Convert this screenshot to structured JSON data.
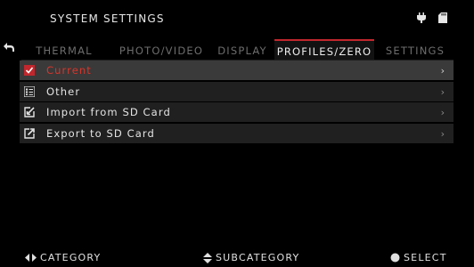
{
  "header": {
    "title": "SYSTEM SETTINGS",
    "status_icons": [
      "plug-icon",
      "sd-card-icon"
    ]
  },
  "back_icon": "back-arrow-icon",
  "tabs": [
    {
      "label": "THERMAL",
      "active": false
    },
    {
      "label": "PHOTO/VIDEO",
      "active": false
    },
    {
      "label": "DISPLAY",
      "active": false
    },
    {
      "label": "PROFILES/ZERO",
      "active": true
    },
    {
      "label": "SETTINGS",
      "active": false
    }
  ],
  "menu": {
    "items": [
      {
        "label": "Current",
        "icon": "checkbox-icon",
        "selected": true
      },
      {
        "label": "Other",
        "icon": "list-icon",
        "selected": false
      },
      {
        "label": "Import from SD Card",
        "icon": "import-icon",
        "selected": false
      },
      {
        "label": "Export to SD Card",
        "icon": "export-icon",
        "selected": false
      }
    ],
    "chevron": "›"
  },
  "footer": {
    "category": "CATEGORY",
    "subcategory": "SUBCATEGORY",
    "select": "SELECT"
  },
  "colors": {
    "accent": "#c1272d",
    "selected_text": "#d8352b",
    "background": "#000000"
  }
}
